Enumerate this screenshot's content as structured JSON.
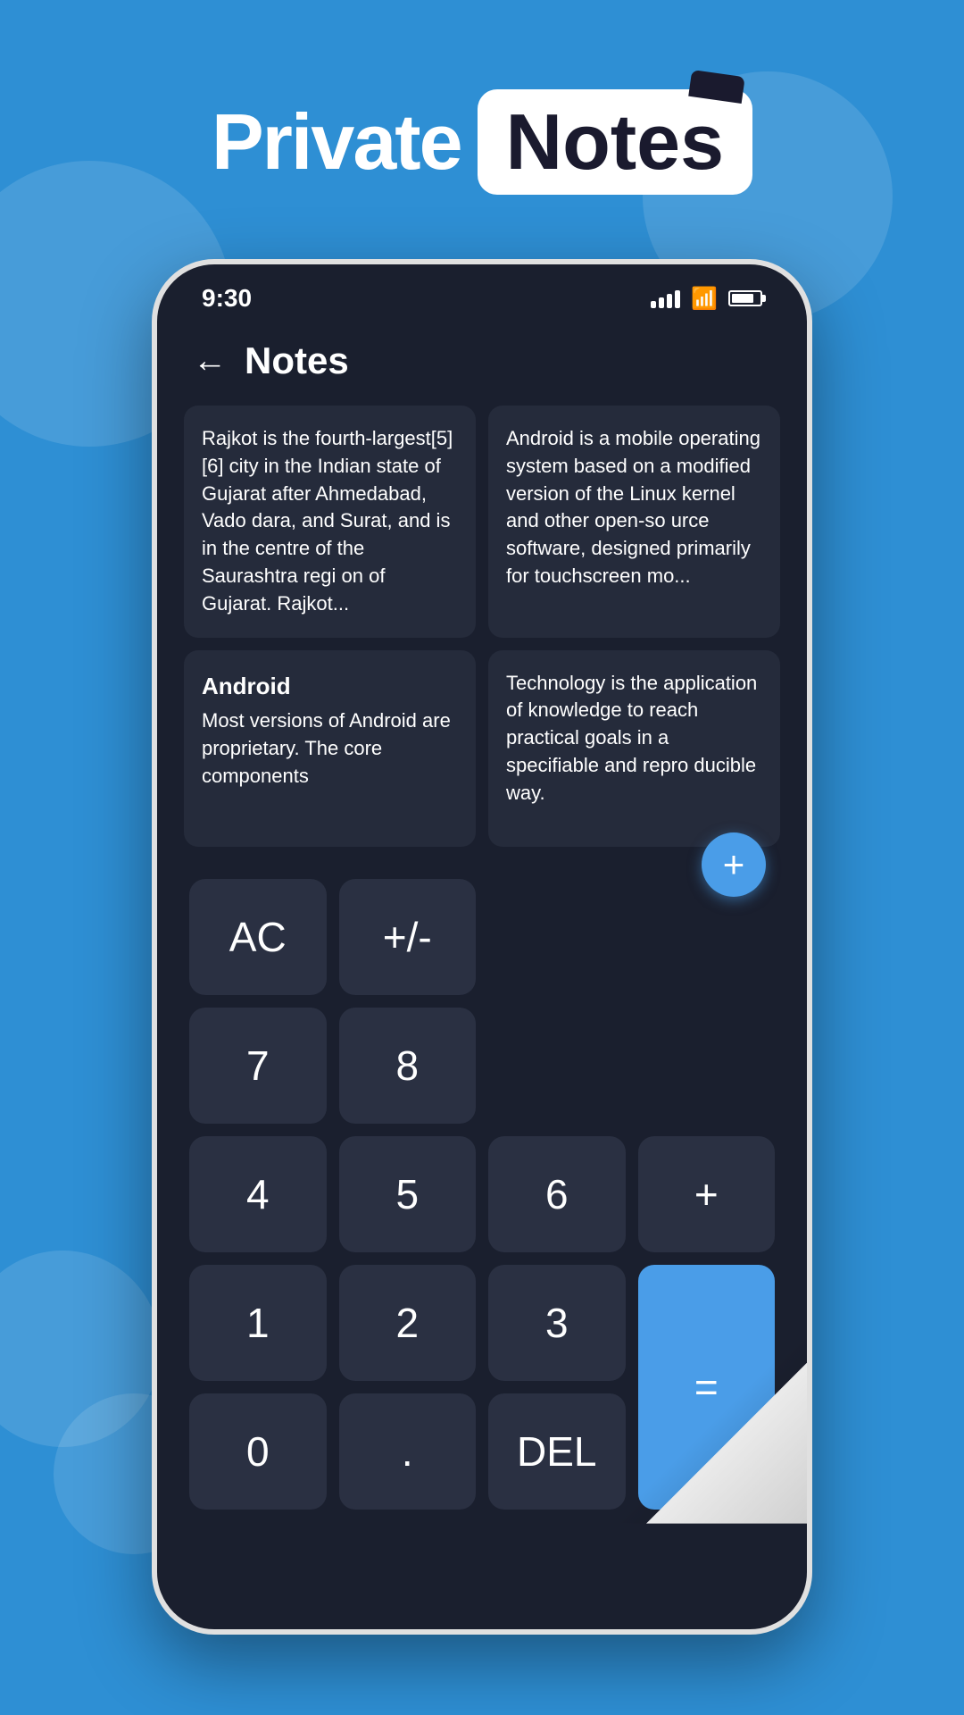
{
  "background": {
    "color": "#2e8fd4"
  },
  "title": {
    "private": "Private",
    "notes": "Notes"
  },
  "status_bar": {
    "time": "9:30"
  },
  "app_header": {
    "back_label": "←",
    "title": "Notes"
  },
  "notes": [
    {
      "id": "note-1",
      "title": "",
      "content": "Rajkot  is the fourth-largest[5][6] city in the Indian state of Gujarat after  Ahmedabad, Vado dara, and Surat, and is in the centre of the Saurashtra regi on of Gujarat. Rajkot..."
    },
    {
      "id": "note-2",
      "title": "",
      "content": "Android is a mobile operating system based on a modified version of the Linux kernel and other open-so urce software, designed primarily for touchscreen mo..."
    },
    {
      "id": "note-3",
      "title": "Android",
      "content": "Most versions of Android are proprietary. The core components"
    },
    {
      "id": "note-4",
      "title": "",
      "content": "Technology is the application of knowledge to reach practical goals in a specifiable and repro ducible way."
    }
  ],
  "calculator": {
    "keys": [
      {
        "label": "AC",
        "type": "function",
        "col": 1,
        "row": 1
      },
      {
        "label": "+/-",
        "type": "function",
        "col": 2,
        "row": 1
      },
      {
        "label": "",
        "type": "empty",
        "col": 3,
        "row": 1
      },
      {
        "label": "",
        "type": "empty",
        "col": 4,
        "row": 1
      },
      {
        "label": "7",
        "type": "number",
        "col": 1,
        "row": 2
      },
      {
        "label": "8",
        "type": "number",
        "col": 2,
        "row": 2
      },
      {
        "label": "",
        "type": "empty",
        "col": 3,
        "row": 2
      },
      {
        "label": "",
        "type": "empty",
        "col": 4,
        "row": 2
      },
      {
        "label": "4",
        "type": "number",
        "col": 1,
        "row": 3
      },
      {
        "label": "5",
        "type": "number",
        "col": 2,
        "row": 3
      },
      {
        "label": "6",
        "type": "number",
        "col": 3,
        "row": 3
      },
      {
        "label": "+",
        "type": "operator",
        "col": 4,
        "row": 3
      },
      {
        "label": "1",
        "type": "number",
        "col": 1,
        "row": 4
      },
      {
        "label": "2",
        "type": "number",
        "col": 2,
        "row": 4
      },
      {
        "label": "3",
        "type": "number",
        "col": 3,
        "row": 4
      },
      {
        "label": "=",
        "type": "equals",
        "col": 4,
        "row": 4
      },
      {
        "label": "0",
        "type": "number",
        "col": 1,
        "row": 5
      },
      {
        "label": ".",
        "type": "number",
        "col": 2,
        "row": 5
      },
      {
        "label": "DEL",
        "type": "function",
        "col": 3,
        "row": 5
      }
    ],
    "fab_label": "+"
  }
}
